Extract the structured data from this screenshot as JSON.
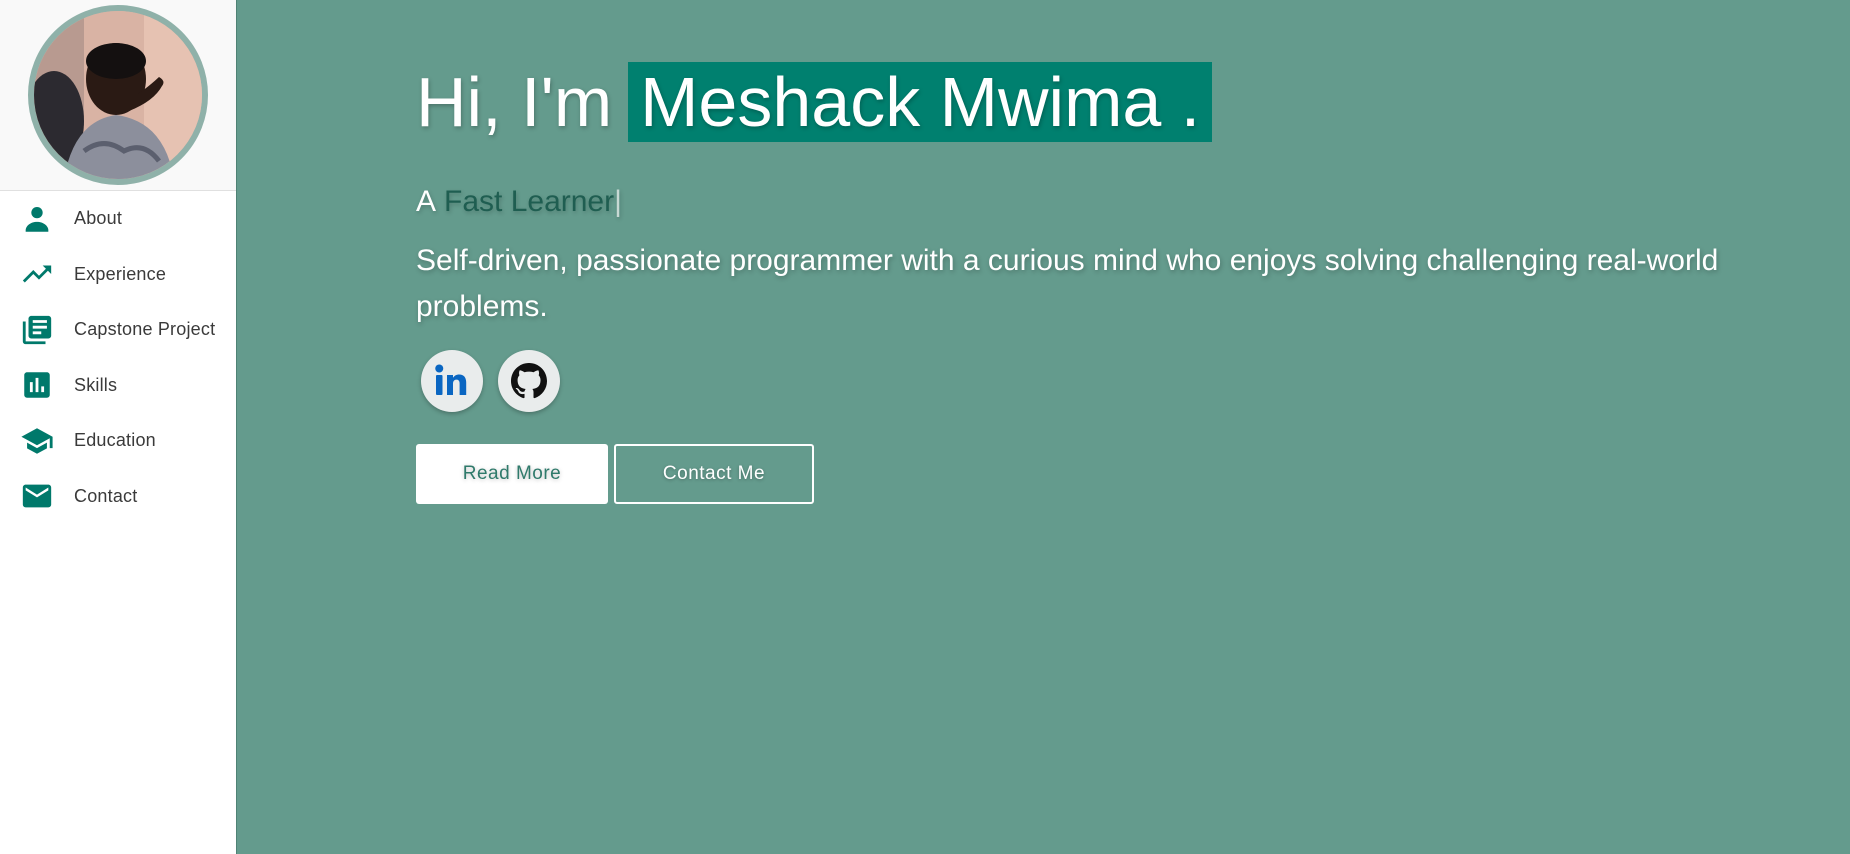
{
  "sidebar": {
    "profile_image_alt": "Profile photo",
    "items": [
      {
        "label": "About",
        "icon": "person-icon"
      },
      {
        "label": "Experience",
        "icon": "trending-up-icon"
      },
      {
        "label": "Capstone Project",
        "icon": "library-books-icon"
      },
      {
        "label": "Skills",
        "icon": "bar-chart-icon"
      },
      {
        "label": "Education",
        "icon": "school-icon"
      },
      {
        "label": "Contact",
        "icon": "mail-icon"
      }
    ]
  },
  "hero": {
    "greeting": "Hi, I'm",
    "name": "Meshack Mwima .",
    "tagline_prefix": "A",
    "tagline_role": "Fast Learner",
    "cursor": "|",
    "description": "Self-driven, passionate programmer with a curious mind who enjoys solving challenging real-world problems.",
    "socials": [
      {
        "name": "LinkedIn",
        "icon": "linkedin-icon"
      },
      {
        "name": "GitHub",
        "icon": "github-icon"
      }
    ],
    "buttons": {
      "read_more": "Read More",
      "contact_me": "Contact Me"
    }
  },
  "colors": {
    "accent": "#00796b",
    "main_background": "#649b8d",
    "name_highlight": "#00806f",
    "sidebar_background": "#ffffff"
  }
}
